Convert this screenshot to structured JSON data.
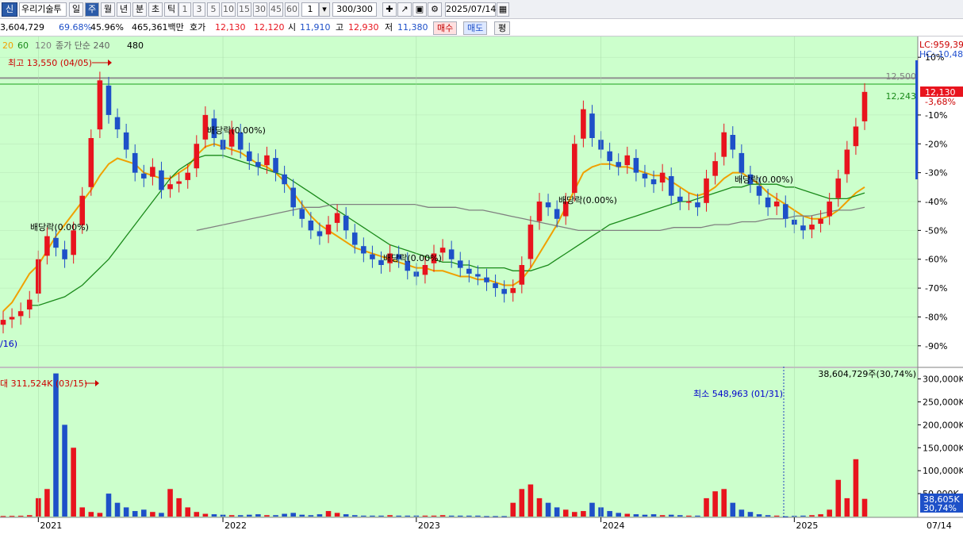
{
  "toolbar": {
    "code_badge": "신",
    "stock_name": "우리기술투",
    "periods": [
      "일",
      "주",
      "월",
      "년",
      "분",
      "초",
      "틱"
    ],
    "active_period": "주",
    "minute_options": [
      "1",
      "3",
      "5",
      "10",
      "15",
      "30",
      "45",
      "60"
    ],
    "unit_value": "1",
    "count_value": "300/300",
    "date_value": "2025/07/14"
  },
  "infobar": {
    "volume": "3,604,729",
    "rate1": "69.68%",
    "rate2": "45.96%",
    "amount": "465,361백만",
    "bid_label": "호가",
    "ask_price": "12,130",
    "bid_price": "12,120",
    "open_label": "시",
    "open_value": "11,910",
    "high_label": "고",
    "high_value": "12,930",
    "low_label": "저",
    "low_value": "11,380",
    "buy_label": "매수",
    "sell_label": "매도",
    "eval_label": "평"
  },
  "legend": {
    "ma20": "20",
    "ma60": "60",
    "ma120": "120",
    "close_simple": "종가 단순 240",
    "ma480": "480"
  },
  "colors": {
    "chart_bg": "#ccffcc",
    "up": "#e8141e",
    "down": "#1e50c8",
    "ma5": "#0000cc",
    "ma20": "#f0a000",
    "ma60": "#1a8a1a",
    "ma120": "#808080"
  },
  "annotations": {
    "high_marker": "최고 13,550 (04/05)",
    "low_date_fragment": "/16)",
    "dividends": [
      "배당락(0.00%)",
      "배당락(0.00%)",
      "배당락(0.00%)",
      "배당락(0.00%)",
      "배당락(0.00%)"
    ],
    "vol_max_marker": "대 311,524K (03/15)",
    "vol_min_marker": "최소 548,963 (01/31)",
    "vol_current_marker": "38,604,729주(30,74%)"
  },
  "right_axis": {
    "lc": "LC:959,39",
    "hc": "HC:-10,48",
    "ref_12500": "12,500",
    "ref_12243": "12,243",
    "current_price": "12,130",
    "current_pct": "-3,68%",
    "price_ticks": [
      "10%",
      "-10%",
      "-20%",
      "-30%",
      "-40%",
      "-50%",
      "-60%",
      "-70%",
      "-80%",
      "-90%"
    ],
    "volume_ticks": [
      "300,000K",
      "250,000K",
      "200,000K",
      "150,000K",
      "100,000K",
      "50,000K"
    ],
    "volume_current": "38,605K",
    "volume_pct": "30,74%"
  },
  "x_axis": {
    "years": [
      "2021",
      "2022",
      "2023",
      "2024",
      "2025"
    ],
    "last_date": "07/14"
  },
  "chart_data": {
    "type": "candlestick",
    "period": "weekly",
    "price_axis_unit": "% from reference",
    "price_ylim": [
      -95,
      15
    ],
    "volume_ylim_k": [
      0,
      320000
    ],
    "reference_lines_pct": [
      {
        "label": "12,500",
        "value": 2.8
      },
      {
        "label": "12,243",
        "value": 0.7
      }
    ],
    "current_price_pct": 0,
    "candles_close_pct": [
      -81,
      -80,
      -78,
      -74,
      -60,
      -52,
      -56,
      -60,
      -50,
      -38,
      -18,
      2,
      -10,
      -15,
      -22,
      -30,
      -32,
      -28,
      -36,
      -34,
      -33,
      -30,
      -20,
      -10,
      -18,
      -22,
      -15,
      -22,
      -26,
      -28,
      -24,
      -30,
      -34,
      -42,
      -46,
      -50,
      -52,
      -48,
      -44,
      -50,
      -55,
      -58,
      -60,
      -62,
      -58,
      -60,
      -64,
      -66,
      -62,
      -58,
      -56,
      -60,
      -63,
      -65,
      -66,
      -68,
      -70,
      -72,
      -70,
      -62,
      -48,
      -40,
      -42,
      -46,
      -40,
      -20,
      -8,
      -18,
      -22,
      -26,
      -28,
      -24,
      -30,
      -32,
      -34,
      -30,
      -38,
      -40,
      -40,
      -42,
      -32,
      -26,
      -16,
      -22,
      -30,
      -34,
      -38,
      -42,
      -40,
      -46,
      -48,
      -50,
      -48,
      -46,
      -40,
      -32,
      -22,
      -14,
      -2
    ],
    "volume_k": [
      1200,
      1500,
      1800,
      3000,
      40000,
      60000,
      312000,
      200000,
      150000,
      20000,
      10000,
      8000,
      50000,
      30000,
      20000,
      12000,
      15000,
      10000,
      8000,
      60000,
      40000,
      20000,
      10000,
      6000,
      5000,
      4000,
      3000,
      3000,
      4000,
      5000,
      3000,
      3000,
      6000,
      8000,
      4000,
      3000,
      5000,
      12000,
      8000,
      5000,
      3000,
      2000,
      2000,
      2000,
      3000,
      2000,
      2000,
      2000,
      2000,
      2000,
      3000,
      2000,
      2000,
      2000,
      2000,
      1000,
      1000,
      1000,
      30000,
      60000,
      70000,
      40000,
      30000,
      20000,
      15000,
      10000,
      12000,
      30000,
      20000,
      12000,
      8000,
      6000,
      5000,
      4000,
      5000,
      3000,
      4000,
      3000,
      2000,
      2000,
      40000,
      55000,
      60000,
      30000,
      15000,
      10000,
      5000,
      3000,
      2000,
      549,
      1500,
      2000,
      3000,
      5000,
      15000,
      80000,
      40000,
      125000,
      38605
    ],
    "series": [
      {
        "name": "20",
        "values": [
          -78,
          -75,
          -70,
          -65,
          -62,
          -57,
          -52,
          -48,
          -44,
          -40,
          -36,
          -31,
          -27,
          -25,
          -26,
          -27,
          -30,
          -31,
          -32,
          -32,
          -30,
          -28,
          -24,
          -21,
          -20,
          -21,
          -22,
          -23,
          -25,
          -27,
          -28,
          -30,
          -33,
          -37,
          -41,
          -45,
          -48,
          -50,
          -52,
          -54,
          -56,
          -57,
          -58,
          -59,
          -60,
          -61,
          -62,
          -63,
          -63,
          -64,
          -64,
          -65,
          -66,
          -66,
          -67,
          -67,
          -68,
          -69,
          -69,
          -67,
          -63,
          -58,
          -53,
          -48,
          -42,
          -36,
          -30,
          -28,
          -27,
          -27,
          -28,
          -28,
          -29,
          -30,
          -31,
          -31,
          -33,
          -35,
          -37,
          -38,
          -37,
          -35,
          -32,
          -30,
          -30,
          -32,
          -34,
          -37,
          -39,
          -41,
          -43,
          -45,
          -46,
          -46,
          -45,
          -43,
          -40,
          -37,
          -35
        ]
      },
      {
        "name": "60",
        "values": [
          -76,
          -76,
          -75,
          -74,
          -73,
          -71,
          -69,
          -66,
          -63,
          -60,
          -56,
          -52,
          -48,
          -44,
          -40,
          -36,
          -32,
          -29,
          -27,
          -25,
          -24,
          -24,
          -24,
          -25,
          -26,
          -27,
          -28,
          -29,
          -30,
          -31,
          -33,
          -35,
          -37,
          -39,
          -41,
          -43,
          -45,
          -47,
          -49,
          -51,
          -53,
          -55,
          -56,
          -57,
          -58,
          -59,
          -60,
          -61,
          -61,
          -62,
          -62,
          -63,
          -63,
          -63,
          -63,
          -64,
          -64,
          -64,
          -63,
          -62,
          -60,
          -58,
          -56,
          -54,
          -52,
          -50,
          -48,
          -47,
          -46,
          -45,
          -44,
          -43,
          -42,
          -41,
          -40,
          -40,
          -39,
          -38,
          -37,
          -36,
          -35,
          -35,
          -34,
          -34,
          -34,
          -34,
          -35,
          -35,
          -36,
          -37,
          -38,
          -39,
          -39,
          -39,
          -38,
          -37
        ]
      },
      {
        "name": "120",
        "values": [
          -50,
          -49,
          -48,
          -47,
          -46,
          -45,
          -44,
          -43,
          -42,
          -42,
          -41,
          -41,
          -41,
          -41,
          -41,
          -41,
          -41,
          -42,
          -42,
          -42,
          -43,
          -43,
          -44,
          -45,
          -46,
          -47,
          -48,
          -49,
          -50,
          -50,
          -50,
          -50,
          -50,
          -50,
          -50,
          -49,
          -49,
          -49,
          -48,
          -48,
          -47,
          -47,
          -46,
          -46,
          -45,
          -45,
          -44,
          -43,
          -43,
          -42
        ]
      }
    ],
    "x_ticks": [
      "2021",
      "2022",
      "2023",
      "2024",
      "2025",
      "07/14"
    ]
  }
}
